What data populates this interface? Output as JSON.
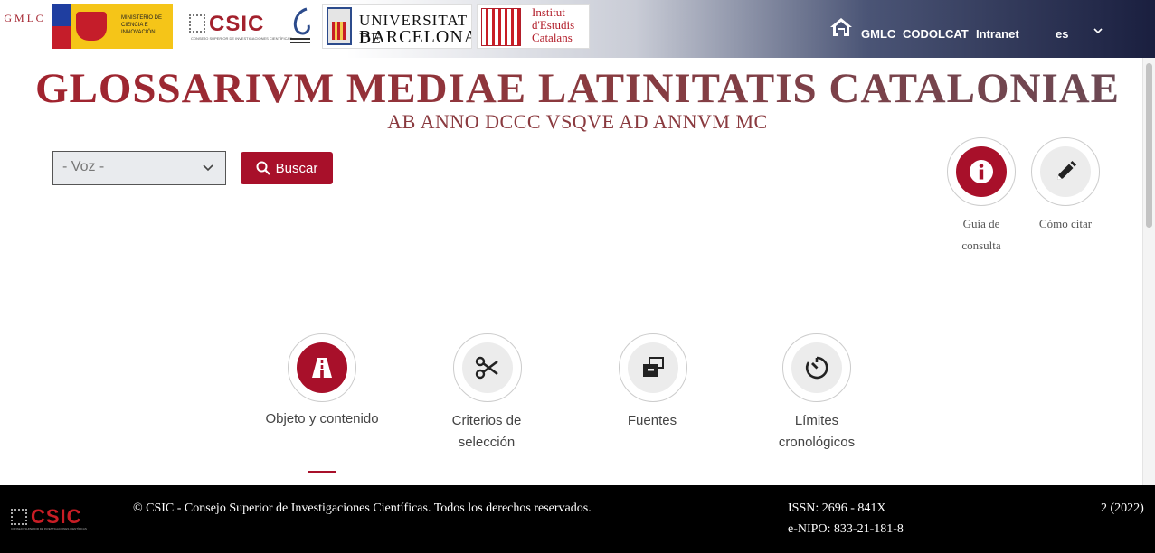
{
  "header": {
    "logos": {
      "gmlc": "G M L C",
      "ministerio": "MINISTERIO DE CIENCIA E INNOVACIÓN",
      "csic": "CSIC",
      "csic_sub": "CONSEJO SUPERIOR DE INVESTIGACIONES CIENTÍFICAS",
      "ub_line1": "UNIVERSITAT DE",
      "ub_line2": "BARCELONA",
      "iec": "Institut d'Estudis Catalans"
    },
    "nav": {
      "gmlc": "GMLC",
      "codolcat": "CODOLCAT",
      "intranet": "Intranet",
      "lang": "es"
    }
  },
  "title": "GLOSSARIVM MEDIAE LATINITATIS CATALONIAE",
  "subtitle": "AB ANNO DCCC VSQVE AD ANNVM MC",
  "search": {
    "select_value": "- Voz -",
    "button": "Buscar"
  },
  "quick_actions": [
    {
      "label_line1": "Guía de",
      "label_line2": "consulta"
    },
    {
      "label_line1": "Cómo citar"
    }
  ],
  "features": [
    {
      "label_line1": "Objeto y contenido",
      "active": true
    },
    {
      "label_line1": "Criterios de",
      "label_line2": "selección"
    },
    {
      "label_line1": "Fuentes"
    },
    {
      "label_line1": "Límites",
      "label_line2": "cronológicos"
    }
  ],
  "footer": {
    "logo": "CSIC",
    "copyright": "© CSIC - Consejo Superior de Investigaciones Científicas. Todos los derechos reservados.",
    "issn": "ISSN: 2696 - 841X",
    "nipo": "e-NIPO: 833-21-181-8",
    "edition": "2 (2022)"
  },
  "colors": {
    "accent": "#a8102a",
    "footer_bg": "#000000"
  }
}
